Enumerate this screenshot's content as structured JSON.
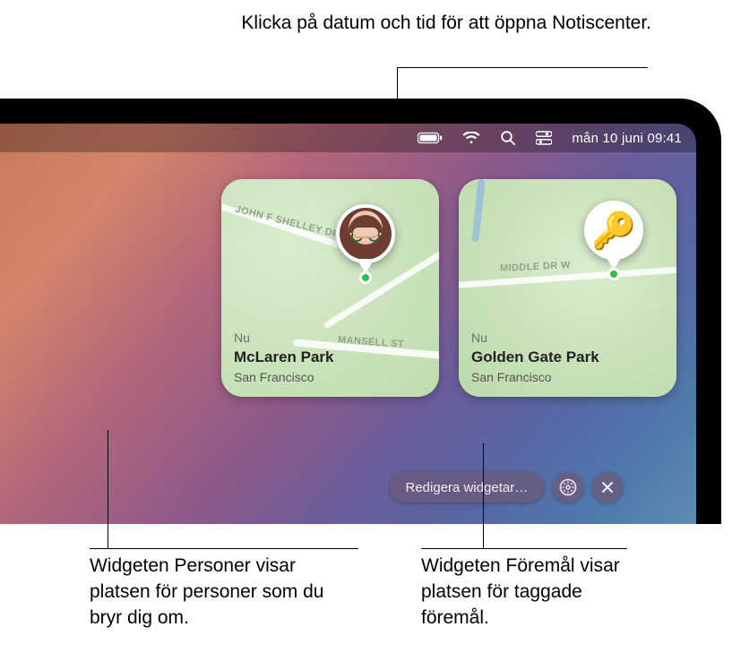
{
  "callouts": {
    "top": "Klicka på datum och tid för att öppna Notiscenter.",
    "bottom_left": "Widgeten Personer visar platsen för personer som du bryr dig om.",
    "bottom_right": "Widgeten Föremål visar platsen för taggade föremål."
  },
  "menubar": {
    "datetime": "mån 10 juni 09:41",
    "icons": {
      "battery": "battery-icon",
      "wifi": "wifi-icon",
      "search": "search-icon",
      "control_center": "control-center-icon"
    }
  },
  "widgets": {
    "people": {
      "now_label": "Nu",
      "title": "McLaren Park",
      "city": "San Francisco",
      "roads": [
        "JOHN F SHELLEY DR",
        "MANSELL ST"
      ],
      "pin_icon": "avatar-icon"
    },
    "items": {
      "now_label": "Nu",
      "title": "Golden Gate Park",
      "city": "San Francisco",
      "roads": [
        "MIDDLE DR W"
      ],
      "pin_icon": "key-icon"
    }
  },
  "editbar": {
    "edit_label": "Redigera widgetar…",
    "settings_icon": "gear-badge-icon",
    "close_icon": "close-icon"
  }
}
